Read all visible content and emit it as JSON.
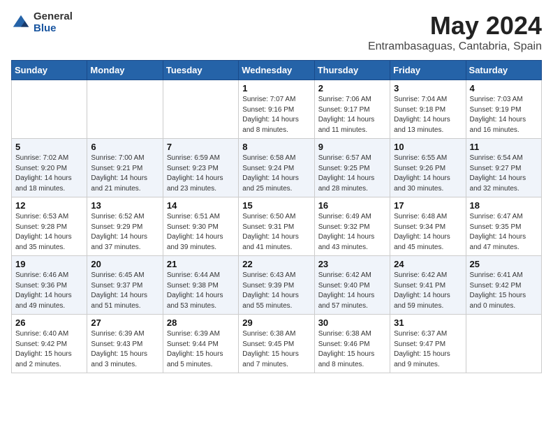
{
  "header": {
    "logo_general": "General",
    "logo_blue": "Blue",
    "month_title": "May 2024",
    "subtitle": "Entrambasaguas, Cantabria, Spain"
  },
  "days_of_week": [
    "Sunday",
    "Monday",
    "Tuesday",
    "Wednesday",
    "Thursday",
    "Friday",
    "Saturday"
  ],
  "weeks": [
    [
      {
        "day": "",
        "info": ""
      },
      {
        "day": "",
        "info": ""
      },
      {
        "day": "",
        "info": ""
      },
      {
        "day": "1",
        "info": "Sunrise: 7:07 AM\nSunset: 9:16 PM\nDaylight: 14 hours\nand 8 minutes."
      },
      {
        "day": "2",
        "info": "Sunrise: 7:06 AM\nSunset: 9:17 PM\nDaylight: 14 hours\nand 11 minutes."
      },
      {
        "day": "3",
        "info": "Sunrise: 7:04 AM\nSunset: 9:18 PM\nDaylight: 14 hours\nand 13 minutes."
      },
      {
        "day": "4",
        "info": "Sunrise: 7:03 AM\nSunset: 9:19 PM\nDaylight: 14 hours\nand 16 minutes."
      }
    ],
    [
      {
        "day": "5",
        "info": "Sunrise: 7:02 AM\nSunset: 9:20 PM\nDaylight: 14 hours\nand 18 minutes."
      },
      {
        "day": "6",
        "info": "Sunrise: 7:00 AM\nSunset: 9:21 PM\nDaylight: 14 hours\nand 21 minutes."
      },
      {
        "day": "7",
        "info": "Sunrise: 6:59 AM\nSunset: 9:23 PM\nDaylight: 14 hours\nand 23 minutes."
      },
      {
        "day": "8",
        "info": "Sunrise: 6:58 AM\nSunset: 9:24 PM\nDaylight: 14 hours\nand 25 minutes."
      },
      {
        "day": "9",
        "info": "Sunrise: 6:57 AM\nSunset: 9:25 PM\nDaylight: 14 hours\nand 28 minutes."
      },
      {
        "day": "10",
        "info": "Sunrise: 6:55 AM\nSunset: 9:26 PM\nDaylight: 14 hours\nand 30 minutes."
      },
      {
        "day": "11",
        "info": "Sunrise: 6:54 AM\nSunset: 9:27 PM\nDaylight: 14 hours\nand 32 minutes."
      }
    ],
    [
      {
        "day": "12",
        "info": "Sunrise: 6:53 AM\nSunset: 9:28 PM\nDaylight: 14 hours\nand 35 minutes."
      },
      {
        "day": "13",
        "info": "Sunrise: 6:52 AM\nSunset: 9:29 PM\nDaylight: 14 hours\nand 37 minutes."
      },
      {
        "day": "14",
        "info": "Sunrise: 6:51 AM\nSunset: 9:30 PM\nDaylight: 14 hours\nand 39 minutes."
      },
      {
        "day": "15",
        "info": "Sunrise: 6:50 AM\nSunset: 9:31 PM\nDaylight: 14 hours\nand 41 minutes."
      },
      {
        "day": "16",
        "info": "Sunrise: 6:49 AM\nSunset: 9:32 PM\nDaylight: 14 hours\nand 43 minutes."
      },
      {
        "day": "17",
        "info": "Sunrise: 6:48 AM\nSunset: 9:34 PM\nDaylight: 14 hours\nand 45 minutes."
      },
      {
        "day": "18",
        "info": "Sunrise: 6:47 AM\nSunset: 9:35 PM\nDaylight: 14 hours\nand 47 minutes."
      }
    ],
    [
      {
        "day": "19",
        "info": "Sunrise: 6:46 AM\nSunset: 9:36 PM\nDaylight: 14 hours\nand 49 minutes."
      },
      {
        "day": "20",
        "info": "Sunrise: 6:45 AM\nSunset: 9:37 PM\nDaylight: 14 hours\nand 51 minutes."
      },
      {
        "day": "21",
        "info": "Sunrise: 6:44 AM\nSunset: 9:38 PM\nDaylight: 14 hours\nand 53 minutes."
      },
      {
        "day": "22",
        "info": "Sunrise: 6:43 AM\nSunset: 9:39 PM\nDaylight: 14 hours\nand 55 minutes."
      },
      {
        "day": "23",
        "info": "Sunrise: 6:42 AM\nSunset: 9:40 PM\nDaylight: 14 hours\nand 57 minutes."
      },
      {
        "day": "24",
        "info": "Sunrise: 6:42 AM\nSunset: 9:41 PM\nDaylight: 14 hours\nand 59 minutes."
      },
      {
        "day": "25",
        "info": "Sunrise: 6:41 AM\nSunset: 9:42 PM\nDaylight: 15 hours\nand 0 minutes."
      }
    ],
    [
      {
        "day": "26",
        "info": "Sunrise: 6:40 AM\nSunset: 9:42 PM\nDaylight: 15 hours\nand 2 minutes."
      },
      {
        "day": "27",
        "info": "Sunrise: 6:39 AM\nSunset: 9:43 PM\nDaylight: 15 hours\nand 3 minutes."
      },
      {
        "day": "28",
        "info": "Sunrise: 6:39 AM\nSunset: 9:44 PM\nDaylight: 15 hours\nand 5 minutes."
      },
      {
        "day": "29",
        "info": "Sunrise: 6:38 AM\nSunset: 9:45 PM\nDaylight: 15 hours\nand 7 minutes."
      },
      {
        "day": "30",
        "info": "Sunrise: 6:38 AM\nSunset: 9:46 PM\nDaylight: 15 hours\nand 8 minutes."
      },
      {
        "day": "31",
        "info": "Sunrise: 6:37 AM\nSunset: 9:47 PM\nDaylight: 15 hours\nand 9 minutes."
      },
      {
        "day": "",
        "info": ""
      }
    ]
  ]
}
